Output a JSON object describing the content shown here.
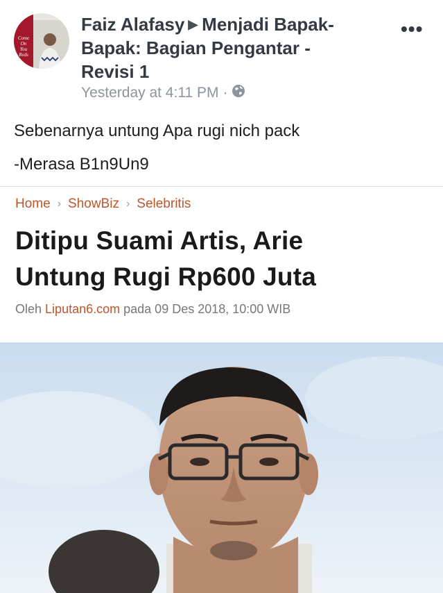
{
  "post": {
    "author": "Faiz Alafasy",
    "group_line1": "Menjadi Bapak-",
    "group_line2": "Bapak: Bagian Pengantar -",
    "group_line3": "Revisi 1",
    "timestamp": "Yesterday at 4:11 PM",
    "meta_separator": "·",
    "more_label": "•••",
    "text_line1": "Sebenarnya untung Apa rugi nich pack",
    "text_line2": "-Merasa B1n9Un9",
    "avatar_badge": [
      "Come",
      "On",
      "You",
      "Reds"
    ]
  },
  "article": {
    "breadcrumb": [
      "Home",
      "ShowBiz",
      "Selebritis"
    ],
    "breadcrumb_sep": "›",
    "headline_line1": "Ditipu Suami Artis, Arie",
    "headline_line2": "Untung Rugi Rp600 Juta",
    "byline_prefix": "Oleh",
    "byline_source": "Liputan6.com",
    "byline_suffix": "pada 09 Des 2018, 10:00 WIB"
  },
  "colors": {
    "accent_orange": "#c0552a",
    "text_dark": "#333a44",
    "meta_gray": "#8d949e"
  },
  "icons": {
    "arrow": "triangle-right-icon",
    "privacy": "globe-icon",
    "more": "more-options-icon"
  }
}
